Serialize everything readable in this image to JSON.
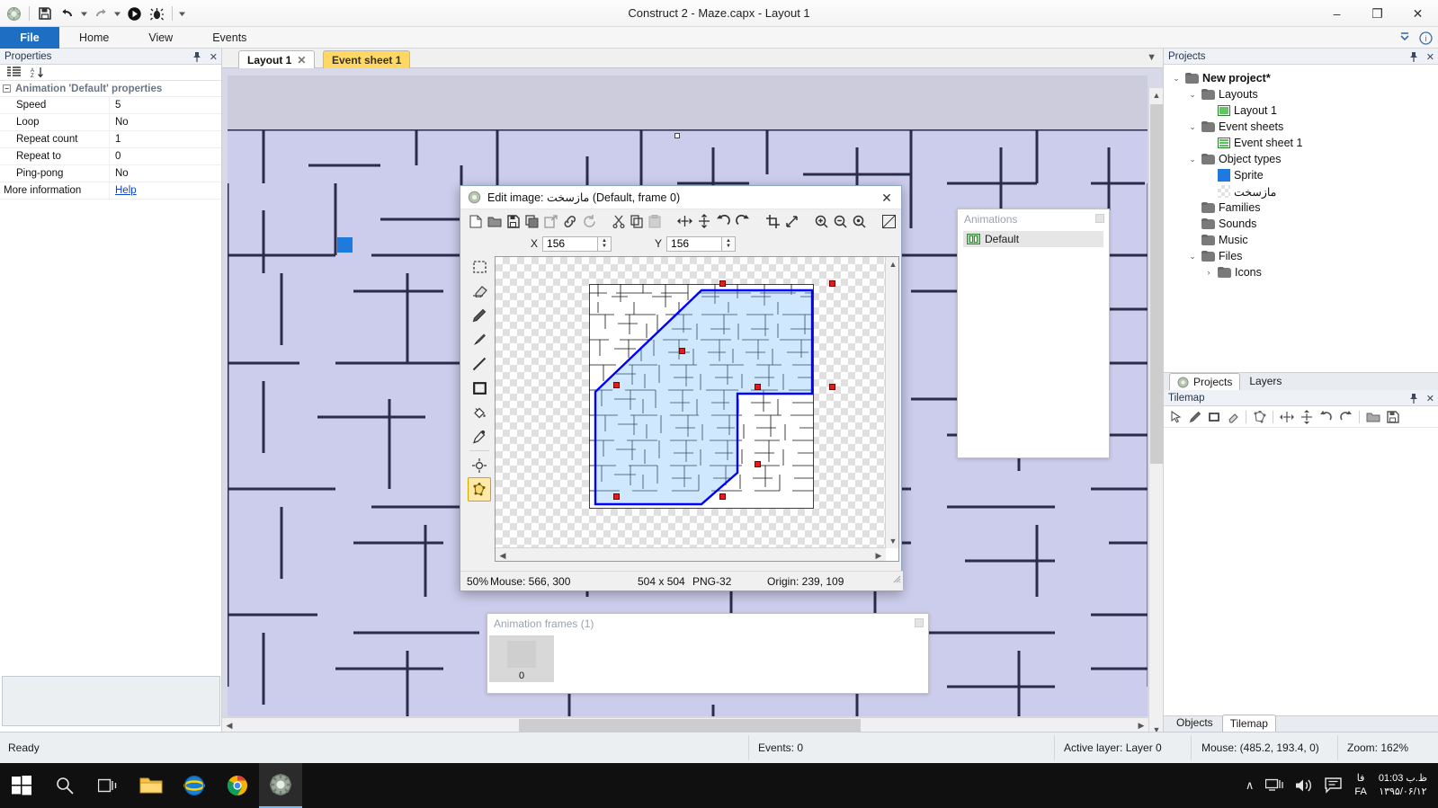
{
  "window": {
    "title": "Construct 2 - Maze.capx - Layout 1",
    "minimize": "–",
    "maximize": "❐",
    "close": "✕"
  },
  "quick_access": {
    "app_icon": "construct2-icon",
    "items": [
      {
        "name": "save-icon",
        "glyph": "save"
      },
      {
        "name": "undo-icon",
        "glyph": "undo"
      },
      {
        "name": "undo-dropdown-icon",
        "glyph": "caret"
      },
      {
        "name": "redo-icon",
        "glyph": "redo"
      },
      {
        "name": "redo-dropdown-icon",
        "glyph": "caret"
      },
      {
        "name": "run-layout-icon",
        "glyph": "play"
      },
      {
        "name": "debug-layout-icon",
        "glyph": "bug"
      },
      {
        "name": "customize-qat-icon",
        "glyph": "caret"
      }
    ]
  },
  "ribbon": {
    "tabs": [
      {
        "label": "File",
        "active": true
      },
      {
        "label": "Home",
        "active": false
      },
      {
        "label": "View",
        "active": false
      },
      {
        "label": "Events",
        "active": false
      }
    ],
    "right_icons": [
      "minimize-ribbon-icon",
      "help-icon"
    ]
  },
  "properties": {
    "title": "Properties",
    "pin": "📌",
    "close": "✕",
    "toolbar": [
      "categorize-icon",
      "sort-alpha-icon"
    ],
    "group_title": "Animation 'Default' properties",
    "rows": [
      {
        "key": "Speed",
        "value": "5"
      },
      {
        "key": "Loop",
        "value": "No"
      },
      {
        "key": "Repeat count",
        "value": "1"
      },
      {
        "key": "Repeat to",
        "value": "0"
      },
      {
        "key": "Ping-pong",
        "value": "No"
      }
    ],
    "more_info_label": "More information",
    "more_info_link": "Help"
  },
  "document_tabs": [
    {
      "label": "Layout 1",
      "active": true,
      "closable": true,
      "close": "✕"
    },
    {
      "label": "Event sheet 1",
      "active": false,
      "closable": false
    }
  ],
  "edit_image": {
    "title": "Edit image: مازسخت (Default, frame 0)",
    "close": "✕",
    "toolbar": [
      "new-image-icon",
      "open-image-icon",
      "save-image-icon",
      "copy-to-clipboard-icon",
      "export-icon",
      "link-icon",
      "reload-icon",
      "cut-icon",
      "copy-icon",
      "paste-icon",
      "mirror-icon",
      "flip-icon",
      "rotate-left-icon",
      "rotate-right-icon",
      "crop-icon",
      "resize-icon",
      "zoom-in-icon",
      "zoom-out-icon",
      "zoom-reset-icon",
      "checker-toggle-icon"
    ],
    "x_label": "X",
    "x_value": "156",
    "y_label": "Y",
    "y_value": "156",
    "tools": [
      "rectangle-select-tool",
      "eraser-tool",
      "pencil-tool",
      "brush-tool",
      "line-tool",
      "rectangle-tool",
      "fill-tool",
      "eyedropper-tool",
      "set-origin-tool",
      "collision-polygon-tool"
    ],
    "selected_tool": "collision-polygon-tool",
    "status": {
      "zoom": "50%",
      "mouse": "Mouse: 566, 300",
      "size": "504 x 504",
      "format": "PNG-32",
      "origin": "Origin: 239, 109"
    }
  },
  "animations_window": {
    "title": "Animations",
    "items": [
      {
        "label": "Default",
        "selected": true
      }
    ]
  },
  "frames_window": {
    "title": "Animation frames (1)",
    "frames": [
      {
        "index": "0"
      }
    ]
  },
  "projects": {
    "title": "Projects",
    "pin": "📌",
    "close": "✕",
    "tree": [
      {
        "label": "New project*",
        "indent": 0,
        "arrow": "⌄",
        "icon": "folder-icon",
        "bold": true
      },
      {
        "label": "Layouts",
        "indent": 1,
        "arrow": "⌄",
        "icon": "folder-icon",
        "bold": false
      },
      {
        "label": "Layout 1",
        "indent": 2,
        "arrow": "",
        "icon": "layout-icon",
        "bold": false
      },
      {
        "label": "Event sheets",
        "indent": 1,
        "arrow": "⌄",
        "icon": "folder-icon",
        "bold": false
      },
      {
        "label": "Event sheet 1",
        "indent": 2,
        "arrow": "",
        "icon": "eventsheet-icon",
        "bold": false
      },
      {
        "label": "Object types",
        "indent": 1,
        "arrow": "⌄",
        "icon": "folder-icon",
        "bold": false
      },
      {
        "label": "Sprite",
        "indent": 2,
        "arrow": "",
        "icon": "sprite-icon",
        "bold": false
      },
      {
        "label": "مازسخت",
        "indent": 2,
        "arrow": "",
        "icon": "checker-sprite-icon",
        "bold": false
      },
      {
        "label": "Families",
        "indent": 1,
        "arrow": "",
        "icon": "folder-icon",
        "bold": false
      },
      {
        "label": "Sounds",
        "indent": 1,
        "arrow": "",
        "icon": "folder-icon",
        "bold": false
      },
      {
        "label": "Music",
        "indent": 1,
        "arrow": "",
        "icon": "folder-icon",
        "bold": false
      },
      {
        "label": "Files",
        "indent": 1,
        "arrow": "⌄",
        "icon": "folder-icon",
        "bold": false
      },
      {
        "label": "Icons",
        "indent": 2,
        "arrow": "›",
        "icon": "folder-icon",
        "bold": false
      }
    ],
    "dock_tabs": [
      {
        "label": "Projects",
        "active": true,
        "icon": "projects-icon"
      },
      {
        "label": "Layers",
        "active": false,
        "icon": ""
      }
    ]
  },
  "tilemap": {
    "title": "Tilemap",
    "pin": "📌",
    "close": "✕",
    "tools": [
      "pointer-tool-icon",
      "pencil-tool-icon",
      "rectangle-tool-icon",
      "eraser-tool-icon",
      "tile-shape-icon",
      "mirror-icon",
      "flip-icon",
      "rotate-left-icon",
      "rotate-right-icon",
      "open-tilemap-icon",
      "save-tilemap-icon"
    ],
    "dock_tabs": [
      {
        "label": "Objects",
        "active": false
      },
      {
        "label": "Tilemap",
        "active": true
      }
    ]
  },
  "statusbar": {
    "ready": "Ready",
    "events": "Events: 0",
    "active_layer": "Active layer: Layer 0",
    "mouse": "Mouse: (485.2, 193.4, 0)",
    "zoom": "Zoom: 162%"
  },
  "taskbar": {
    "start": "start-button",
    "items": [
      {
        "name": "search-icon"
      },
      {
        "name": "task-view-icon"
      },
      {
        "name": "file-explorer-icon"
      },
      {
        "name": "internet-explorer-icon"
      },
      {
        "name": "chrome-icon"
      },
      {
        "name": "construct2-icon"
      }
    ],
    "tray": {
      "show_hidden": "∧",
      "network_icon": "network-icon",
      "volume_icon": "volume-icon",
      "action_center_icon": "action-center-icon",
      "lang_top": "فا",
      "lang_bottom": "FA",
      "time": "01:03 ظ.ب",
      "date": "۱۳۹۵/۰۶/۱۲"
    }
  },
  "colors": {
    "accent": "#1e6fc4",
    "sheet_tab": "#ffd863",
    "layout_bg": "#ccccec",
    "selection": "#0000ff",
    "vertex": "#e21b1b",
    "sprite": "#1f7ae0"
  }
}
